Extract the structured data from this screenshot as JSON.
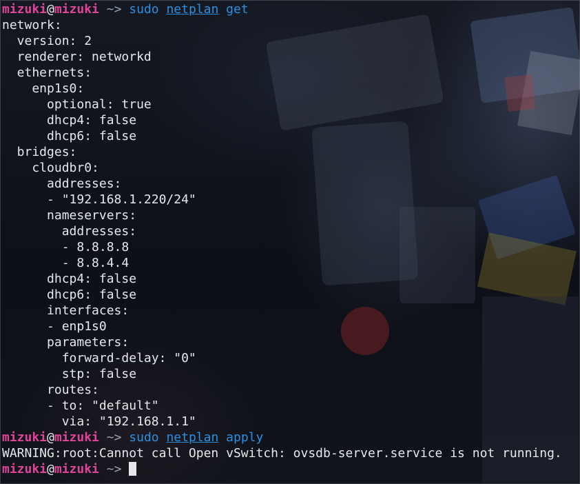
{
  "prompt": {
    "user": "mizuki",
    "at": "@",
    "host": "mizuki",
    "path": " ~> "
  },
  "commands": {
    "get": {
      "sudo": "sudo ",
      "netplan": "netplan",
      "sub": " get"
    },
    "apply": {
      "sudo": "sudo ",
      "netplan": "netplan",
      "sub": " apply"
    }
  },
  "output": [
    "network:",
    "  version: 2",
    "  renderer: networkd",
    "  ethernets:",
    "    enp1s0:",
    "      optional: true",
    "      dhcp4: false",
    "      dhcp6: false",
    "  bridges:",
    "    cloudbr0:",
    "      addresses:",
    "      - \"192.168.1.220/24\"",
    "      nameservers:",
    "        addresses:",
    "        - 8.8.8.8",
    "        - 8.8.4.4",
    "      dhcp4: false",
    "      dhcp6: false",
    "      interfaces:",
    "      - enp1s0",
    "      parameters:",
    "        forward-delay: \"0\"",
    "        stp: false",
    "      routes:",
    "      - to: \"default\"",
    "        via: \"192.168.1.1\""
  ],
  "warning": "WARNING:root:Cannot call Open vSwitch: ovsdb-server.service is not running."
}
